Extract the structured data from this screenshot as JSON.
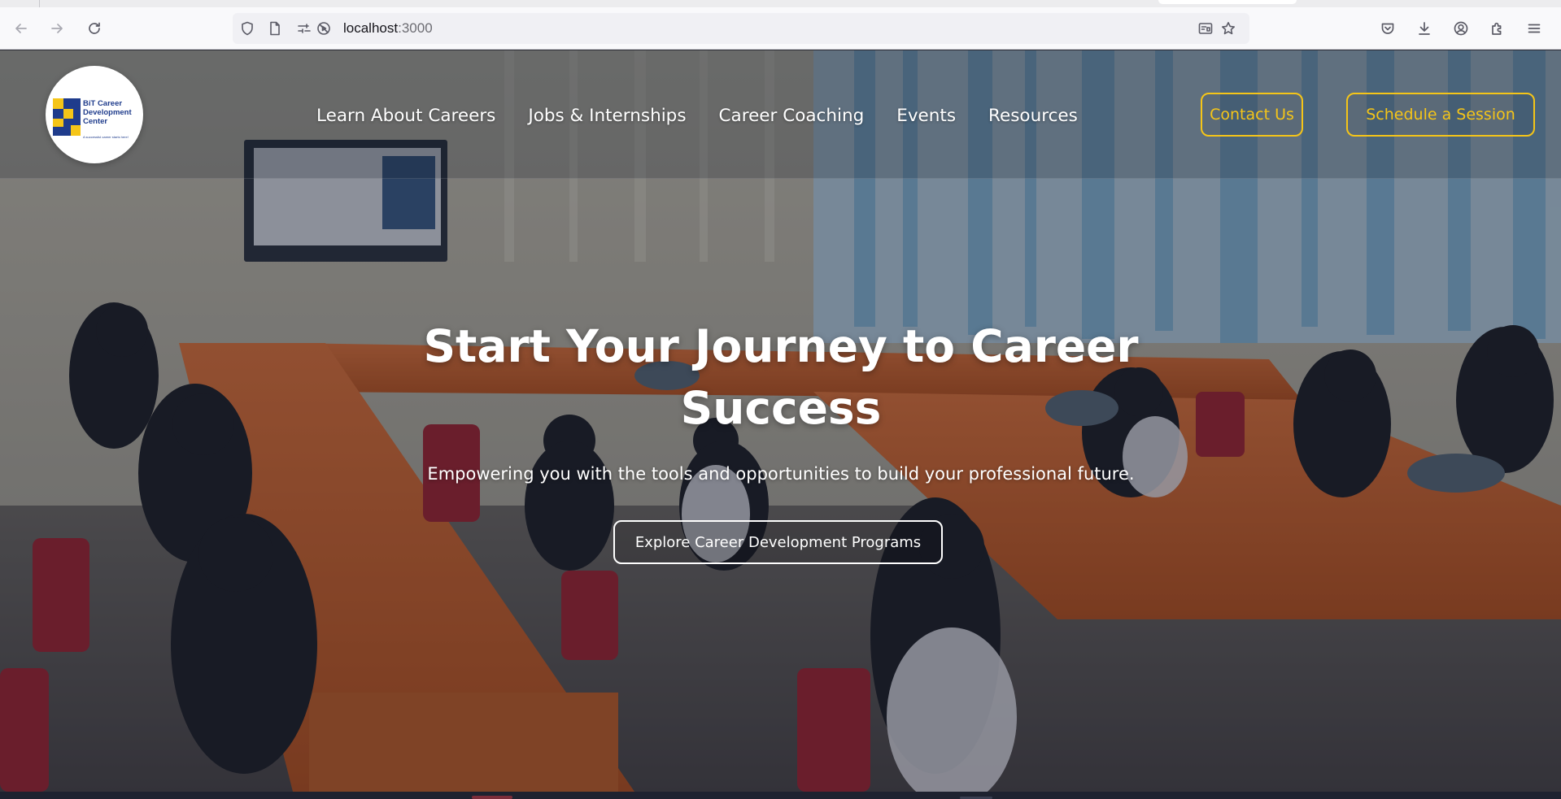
{
  "browser": {
    "url_host": "localhost",
    "url_port": ":3000",
    "icons": {
      "back": "arrow-left-icon",
      "forward": "arrow-right-icon",
      "reload": "reload-icon",
      "tracking": "shield-icon",
      "page": "page-icon",
      "permissions": "permissions-icon",
      "reader": "reader-view-icon",
      "bookmark": "star-icon",
      "pocket": "pocket-icon",
      "downloads": "download-icon",
      "account": "account-icon",
      "extensions": "puzzle-icon",
      "menu": "hamburger-menu-icon"
    }
  },
  "site": {
    "logo": {
      "line1": "BiT Career",
      "line2": "Development",
      "line3": "Center",
      "tagline": "A successful career starts here!"
    },
    "nav": [
      {
        "label": "Learn About Careers"
      },
      {
        "label": "Jobs & Internships"
      },
      {
        "label": "Career Coaching"
      },
      {
        "label": "Events"
      },
      {
        "label": "Resources"
      }
    ],
    "contact_label": "Contact Us",
    "schedule_label": "Schedule a Session",
    "accent_color": "#f5c518"
  },
  "hero": {
    "title": "Start Your Journey to Career Success",
    "subtitle": "Empowering you with the tools and opportunities to build your professional future.",
    "cta_label": "Explore Career Development Programs"
  }
}
